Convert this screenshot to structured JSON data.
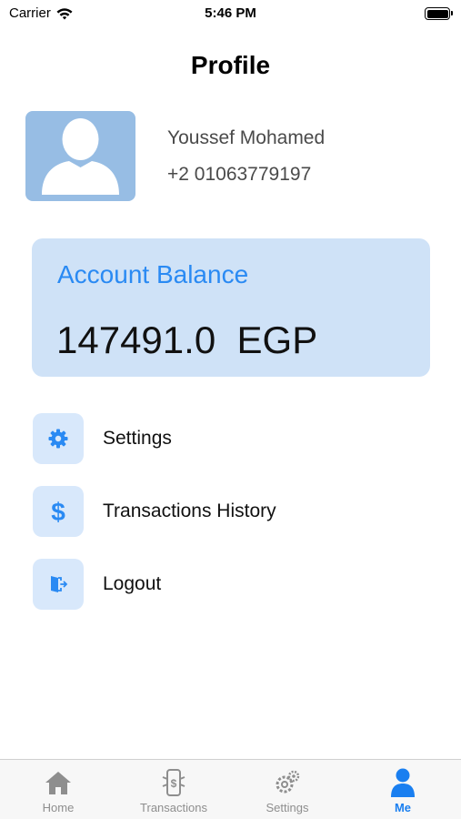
{
  "status_bar": {
    "carrier": "Carrier",
    "time": "5:46 PM"
  },
  "page": {
    "title": "Profile"
  },
  "profile": {
    "name": "Youssef Mohamed",
    "phone": "+2 01063779197",
    "avatar_icon": "person-silhouette-icon"
  },
  "balance": {
    "label": "Account Balance",
    "value": "147491.0  EGP"
  },
  "menu": {
    "items": [
      {
        "label": "Settings",
        "icon": "gear-icon"
      },
      {
        "label": "Transactions History",
        "icon": "dollar-icon"
      },
      {
        "label": "Logout",
        "icon": "logout-door-icon"
      }
    ]
  },
  "tabs": {
    "items": [
      {
        "label": "Home",
        "icon": "house-icon",
        "active": false
      },
      {
        "label": "Transactions",
        "icon": "phone-dollar-icon",
        "active": false
      },
      {
        "label": "Settings",
        "icon": "gears-icon",
        "active": false
      },
      {
        "label": "Me",
        "icon": "person-icon",
        "active": true
      }
    ]
  },
  "colors": {
    "accent": "#2a8af3",
    "card_background": "#cfe2f7",
    "icon_box": "#d8e8fb",
    "avatar_background": "#97bde4",
    "tab_active": "#1a7ff0",
    "tab_inactive": "#8e8e8e"
  }
}
